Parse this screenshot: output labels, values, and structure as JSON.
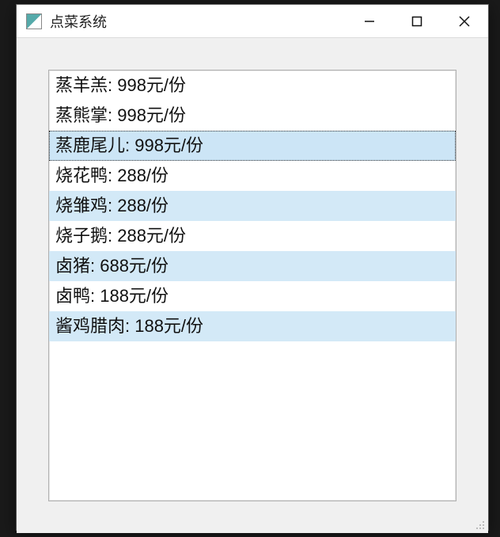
{
  "window": {
    "title": "点菜系统",
    "buttons": {
      "min": "minimize",
      "max": "maximize",
      "close": "close"
    }
  },
  "list": {
    "items": [
      {
        "label": "蒸羊羔: 998元/份",
        "selected": false,
        "alt": false
      },
      {
        "label": "蒸熊掌: 998元/份",
        "selected": false,
        "alt": false
      },
      {
        "label": "蒸鹿尾儿: 998元/份",
        "selected": true,
        "alt": true
      },
      {
        "label": "烧花鸭: 288/份",
        "selected": false,
        "alt": false
      },
      {
        "label": "烧雏鸡: 288/份",
        "selected": false,
        "alt": true
      },
      {
        "label": "烧子鹅: 288元/份",
        "selected": false,
        "alt": false
      },
      {
        "label": "卤猪: 688元/份",
        "selected": false,
        "alt": true
      },
      {
        "label": "卤鸭: 188元/份",
        "selected": false,
        "alt": false
      },
      {
        "label": "酱鸡腊肉: 188元/份",
        "selected": false,
        "alt": true
      }
    ]
  }
}
